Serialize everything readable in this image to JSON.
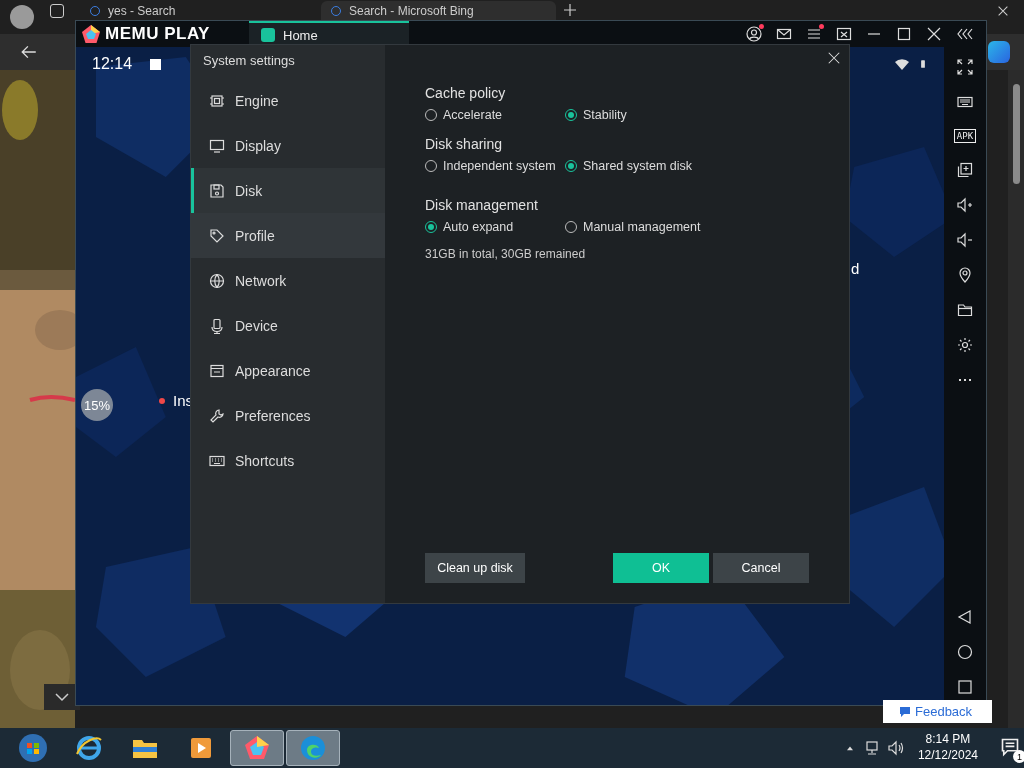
{
  "browser": {
    "tabs": [
      {
        "title": "yes - Search",
        "selected": false
      },
      {
        "title": "Search - Microsoft Bing",
        "selected": true
      }
    ]
  },
  "emulator": {
    "brand": "MEMU PLAY",
    "tabs": [
      {
        "label": "Home",
        "selected": true
      }
    ],
    "clock": "12:14",
    "apk_label": "APK",
    "home_screen": {
      "progress": "15%",
      "labels": [
        "Ins",
        "d"
      ]
    }
  },
  "dialog": {
    "title": "System settings",
    "nav": [
      {
        "label": "Engine",
        "selected": false,
        "hovered": false
      },
      {
        "label": "Display",
        "selected": false,
        "hovered": false
      },
      {
        "label": "Disk",
        "selected": true,
        "hovered": false
      },
      {
        "label": "Profile",
        "selected": false,
        "hovered": true
      },
      {
        "label": "Network",
        "selected": false,
        "hovered": false
      },
      {
        "label": "Device",
        "selected": false,
        "hovered": false
      },
      {
        "label": "Appearance",
        "selected": false,
        "hovered": false
      },
      {
        "label": "Preferences",
        "selected": false,
        "hovered": false
      },
      {
        "label": "Shortcuts",
        "selected": false,
        "hovered": false
      }
    ],
    "sections": [
      {
        "title": "Cache policy",
        "options": [
          {
            "label": "Accelerate",
            "selected": false
          },
          {
            "label": "Stability",
            "selected": true
          }
        ]
      },
      {
        "title": "Disk sharing",
        "options": [
          {
            "label": "Independent system",
            "selected": false
          },
          {
            "label": "Shared system disk",
            "selected": true
          }
        ]
      },
      {
        "title": "Disk management",
        "options": [
          {
            "label": "Auto expand",
            "selected": true
          },
          {
            "label": "Manual management",
            "selected": false
          }
        ],
        "note": "31GB in total, 30GB remained"
      }
    ],
    "buttons": [
      {
        "label": "Clean up disk",
        "kind": "secondary"
      },
      {
        "label": "OK",
        "kind": "primary"
      },
      {
        "label": "Cancel",
        "kind": "secondary"
      }
    ]
  },
  "feedback": "Feedback",
  "taskbar": {
    "apps": [
      {
        "active": false
      },
      {
        "active": false
      },
      {
        "active": false
      },
      {
        "active": false
      },
      {
        "active": true
      },
      {
        "active": true
      }
    ],
    "time": "8:14 PM",
    "date": "12/12/2024",
    "notifications": "1"
  }
}
